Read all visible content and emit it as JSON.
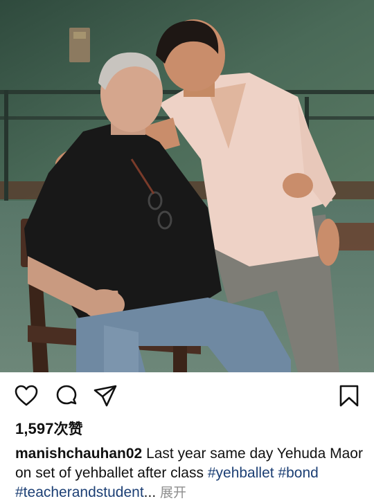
{
  "post": {
    "likes": {
      "count": "1,597",
      "unit": "次赞"
    },
    "caption": {
      "username": "manishchauhan02",
      "text": "Last year same day Yehuda Maor on set of yehballet after class",
      "hashtags": [
        "#yehballet",
        "#bond",
        "#teacherandstudent"
      ],
      "ellipsis": "...",
      "more_label": "展开"
    },
    "icons": {
      "like": "heart-icon",
      "comment": "speech-bubble-icon",
      "share": "paper-plane-icon",
      "save": "bookmark-icon"
    },
    "colors": {
      "text": "#111111",
      "hashtag": "#1c3f74",
      "muted": "#8e8e8e",
      "photo_wall": "#3f5f4e"
    }
  }
}
